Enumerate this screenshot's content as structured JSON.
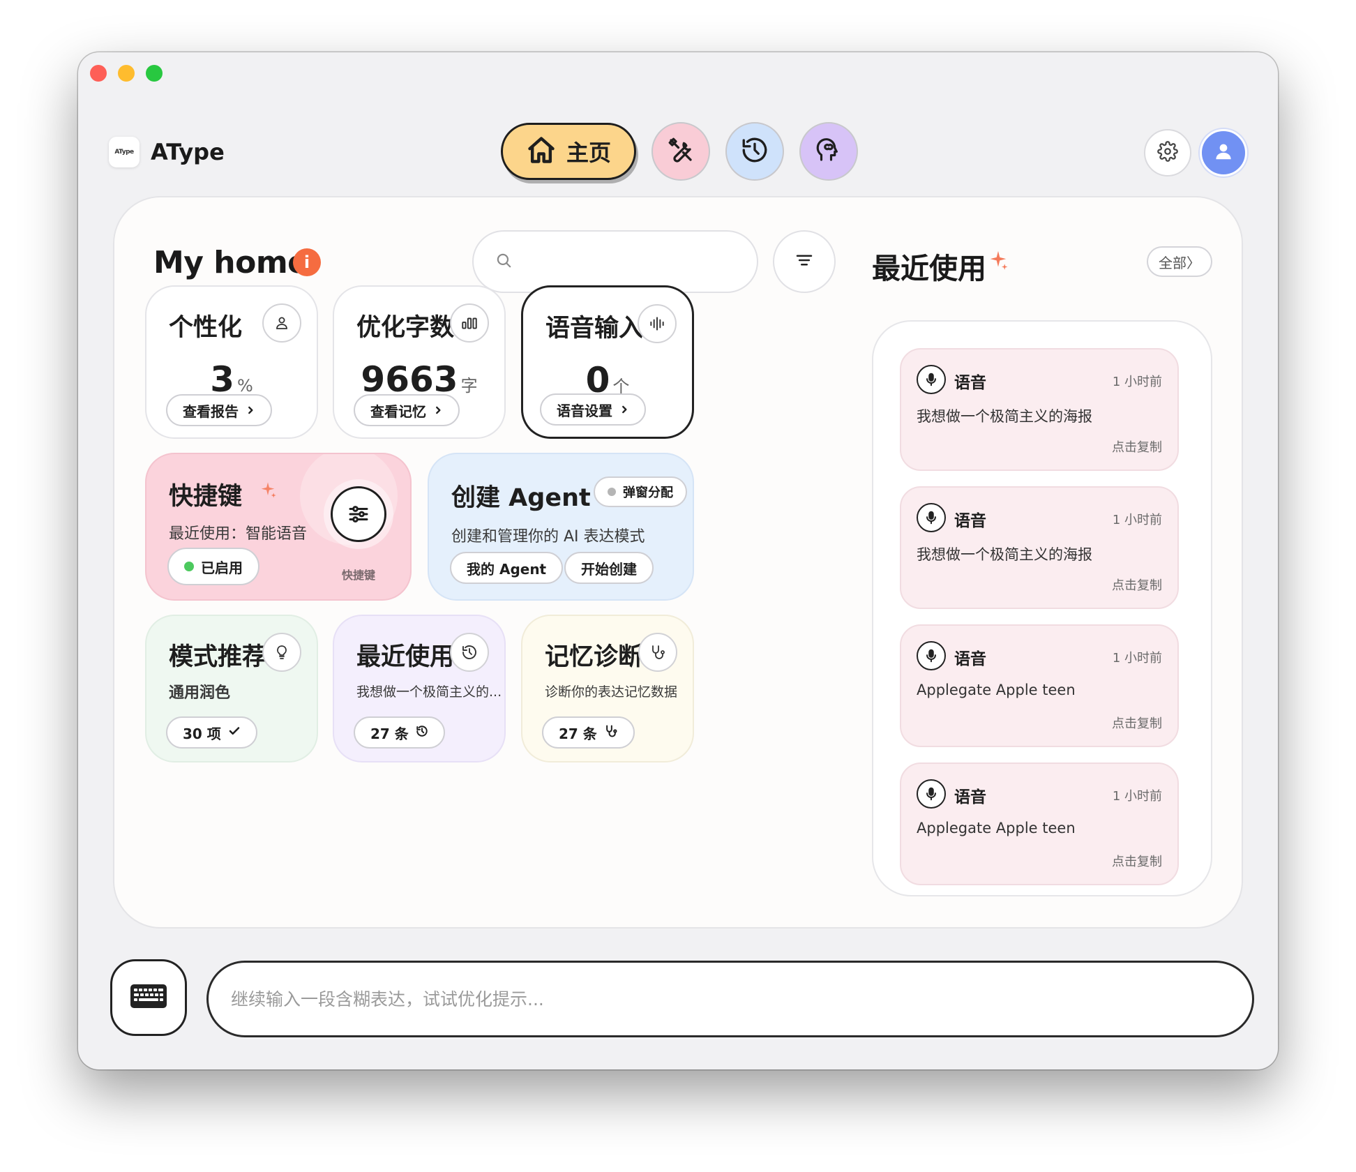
{
  "app": {
    "name": "AType",
    "logo_text": "AType"
  },
  "nav": {
    "home_label": "主页"
  },
  "home": {
    "title": "My home",
    "info_badge": "i",
    "search_placeholder": ""
  },
  "stats": [
    {
      "title": "个性化",
      "value": "3",
      "unit": "%",
      "action": "查看报告",
      "icon": "person-icon"
    },
    {
      "title": "优化字数",
      "value": "9663",
      "unit": "字",
      "action": "查看记忆",
      "icon": "bar-chart-icon"
    },
    {
      "title": "语音输入",
      "value": "0",
      "unit": "个",
      "action": "语音设置",
      "icon": "waveform-icon"
    }
  ],
  "shortcut": {
    "title": "快捷键",
    "subtitle": "最近使用：智能语音",
    "status": "已启用",
    "icon_label": "快捷键"
  },
  "agent": {
    "title": "创建 Agent",
    "badge": "弹窗分配",
    "subtitle": "创建和管理你的 AI 表达模式",
    "btn_my": "我的 Agent",
    "btn_create": "开始创建"
  },
  "mini_cards": [
    {
      "title": "模式推荐",
      "subtitle": "通用润色",
      "count": "30 项",
      "icon": "lightbulb-icon",
      "count_icon": "check-icon"
    },
    {
      "title": "最近使用",
      "subtitle": "我想做一个极简主义的...",
      "count": "27 条",
      "icon": "clock-icon",
      "count_icon": "history-icon"
    },
    {
      "title": "记忆诊断",
      "subtitle": "诊断你的表达记忆数据",
      "count": "27 条",
      "icon": "stethoscope-icon",
      "count_icon": "stethoscope-icon"
    }
  ],
  "recent": {
    "title": "最近使用",
    "all_label": "全部〉",
    "items": [
      {
        "type": "语音",
        "time": "1 小时前",
        "text": "我想做一个极简主义的海报",
        "action": "点击复制"
      },
      {
        "type": "语音",
        "time": "1 小时前",
        "text": "我想做一个极简主义的海报",
        "action": "点击复制"
      },
      {
        "type": "语音",
        "time": "1 小时前",
        "text": "Applegate Apple teen",
        "action": "点击复制"
      },
      {
        "type": "语音",
        "time": "1 小时前",
        "text": "Applegate Apple teen",
        "action": "点击复制"
      }
    ]
  },
  "bottom": {
    "placeholder": "继续输入一段含糊表达，试试优化提示..."
  },
  "colors": {
    "home_nav": "#fcd58b",
    "tools_nav": "#f9ccd6",
    "history_nav": "#cfe2fb",
    "brain_nav": "#d7c3f7",
    "avatar": "#7191f3",
    "accent_orange": "#f56c40",
    "shortcut_card": "#fbd3dc",
    "agent_card": "#e5f0fc",
    "mode_card": "#eff8f1",
    "recent_card": "#f4effd",
    "memory_card": "#fefbef",
    "recent_item": "#fbedf0",
    "enabled_dot": "#4cc95e"
  }
}
